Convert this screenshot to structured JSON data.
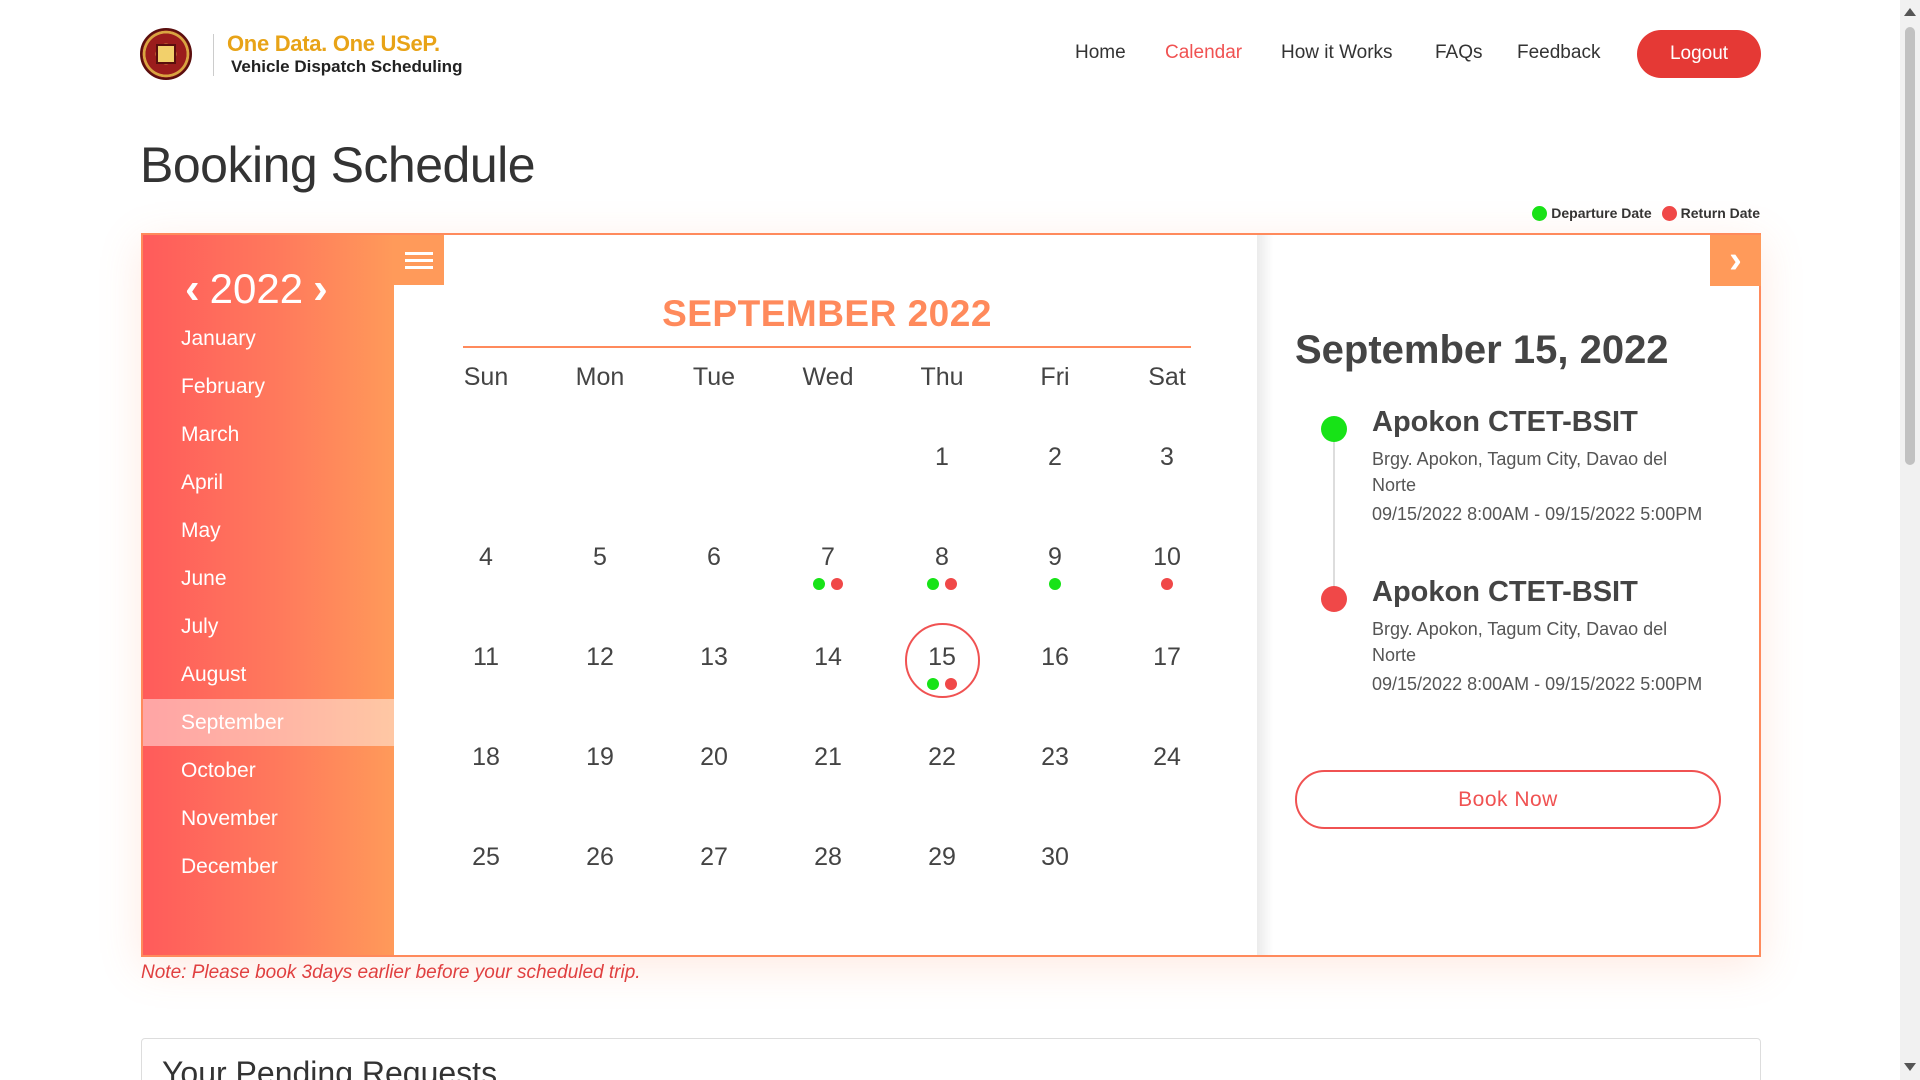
{
  "brand": {
    "tagline_one": "One Data.",
    "tagline_two": "One USeP.",
    "subtitle": "Vehicle Dispatch Scheduling"
  },
  "nav": {
    "home": "Home",
    "calendar": "Calendar",
    "how": "How it Works",
    "faqs": "FAQs",
    "feedback": "Feedback",
    "logout": "Logout"
  },
  "page": {
    "title": "Booking Schedule",
    "note": "Note: Please book 3days earlier before your scheduled trip.",
    "pending_title": "Your Pending Requests"
  },
  "legend": {
    "departure": "Departure Date",
    "return": "Return Date",
    "departure_color": "#17e317",
    "return_color": "#f04848"
  },
  "calendar": {
    "year": "2022",
    "prev_icon": "chevron-left-icon",
    "next_icon": "chevron-right-icon",
    "months": [
      "January",
      "February",
      "March",
      "April",
      "May",
      "June",
      "July",
      "August",
      "September",
      "October",
      "November",
      "December"
    ],
    "active_month": "September",
    "month_title": "SEPTEMBER 2022",
    "weekdays": [
      "Sun",
      "Mon",
      "Tue",
      "Wed",
      "Thu",
      "Fri",
      "Sat"
    ],
    "first_weekday_index": 4,
    "days_in_month": 30,
    "selected_day": 15,
    "markers": {
      "7": [
        "departure",
        "return"
      ],
      "8": [
        "departure",
        "return"
      ],
      "9": [
        "departure"
      ],
      "10": [
        "return"
      ],
      "15": [
        "departure",
        "return"
      ]
    }
  },
  "detail": {
    "date": "September 15, 2022",
    "events": [
      {
        "type": "departure",
        "title": "Apokon CTET-BSIT",
        "address": "Brgy. Apokon, Tagum City, Davao del Norte",
        "time": "09/15/2022 8:00AM - 09/15/2022 5:00PM"
      },
      {
        "type": "return",
        "title": "Apokon CTET-BSIT",
        "address": "Brgy. Apokon, Tagum City, Davao del Norte",
        "time": "09/15/2022 8:00AM - 09/15/2022 5:00PM"
      }
    ],
    "book_label": "Book Now"
  }
}
